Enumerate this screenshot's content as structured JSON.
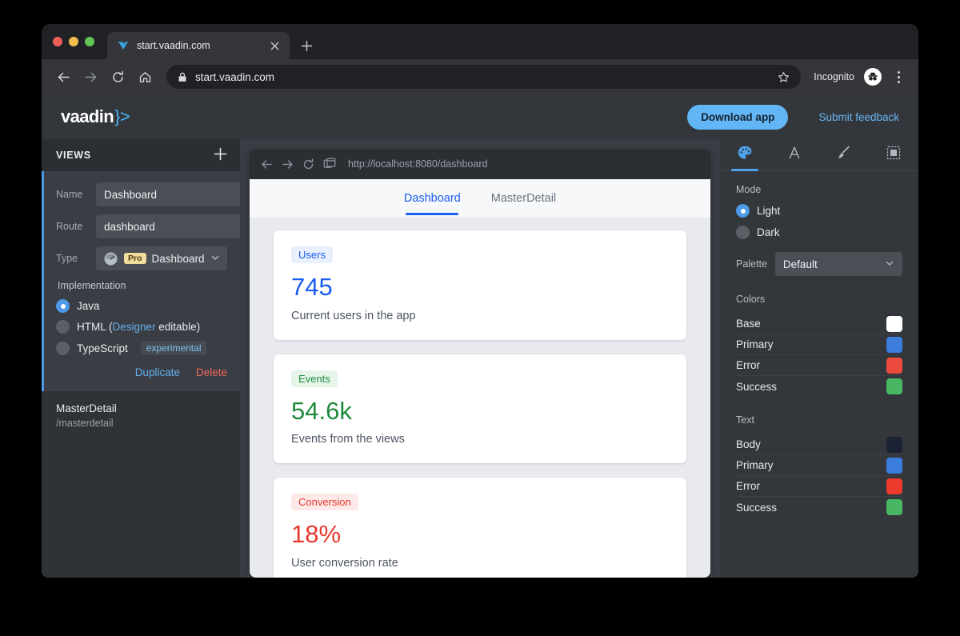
{
  "browser": {
    "tab": {
      "title": "start.vaadin.com",
      "favicon_icon": "vaadin-favicon",
      "close_icon": "close-icon"
    },
    "new_tab_icon": "plus-icon",
    "back_icon": "arrow-left-icon",
    "forward_icon": "arrow-right-icon",
    "reload_icon": "reload-icon",
    "home_icon": "home-icon",
    "lock_icon": "lock-icon",
    "url": "start.vaadin.com",
    "bookmark_icon": "star-icon",
    "profile_label": "Incognito",
    "profile_icon": "incognito-avatar-icon",
    "menu_icon": "kebab-menu-icon"
  },
  "appheader": {
    "logo_text": "vaadin",
    "logo_mark": "}>",
    "download_label": "Download app",
    "feedback_label": "Submit feedback",
    "accent": "#62b6f5"
  },
  "sidebar": {
    "heading": "VIEWS",
    "add_icon": "plus-icon",
    "selected_view": {
      "fields": [
        {
          "label": "Name",
          "value": "Dashboard"
        },
        {
          "label": "Route",
          "value": "dashboard"
        }
      ],
      "type": {
        "label": "Type",
        "icon": "gauge-icon",
        "badge": "Pro",
        "value": "Dashboard",
        "chevron_icon": "chevron-down-icon"
      },
      "implementation": {
        "title": "Implementation",
        "options": [
          {
            "label": "Java",
            "selected": true
          },
          {
            "label": "HTML (",
            "link": "Designer",
            "label_after": " editable)",
            "selected": false
          },
          {
            "label": "TypeScript",
            "tag": "experimental",
            "selected": false
          }
        ]
      },
      "actions": {
        "duplicate": "Duplicate",
        "delete": "Delete"
      },
      "accent": "#4c9ae8"
    },
    "other_views": [
      {
        "name": "MasterDetail",
        "route": "/masterdetail"
      }
    ]
  },
  "preview": {
    "back_icon": "arrow-left-icon",
    "forward_icon": "arrow-right-icon",
    "reload_icon": "reload-icon",
    "windows_icon": "copy-window-icon",
    "url": "http://localhost:8080/dashboard",
    "tabs": [
      {
        "label": "Dashboard",
        "active": true
      },
      {
        "label": "MasterDetail",
        "active": false
      }
    ],
    "cards": [
      {
        "badge": "Users",
        "value": "745",
        "description": "Current users in the app",
        "tone": "blue"
      },
      {
        "badge": "Events",
        "value": "54.6k",
        "description": "Events from the views",
        "tone": "green"
      },
      {
        "badge": "Conversion",
        "value": "18%",
        "description": "User conversion rate",
        "tone": "red"
      }
    ]
  },
  "theme": {
    "tabs": [
      {
        "icon": "palette-icon",
        "active": true
      },
      {
        "icon": "typography-icon",
        "active": false
      },
      {
        "icon": "brush-icon",
        "active": false
      },
      {
        "icon": "shape-icon",
        "active": false
      }
    ],
    "mode": {
      "title": "Mode",
      "options": [
        {
          "label": "Light",
          "selected": true
        },
        {
          "label": "Dark",
          "selected": false
        }
      ]
    },
    "palette": {
      "label": "Palette",
      "value": "Default",
      "chevron_icon": "chevron-down-icon"
    },
    "colors": {
      "title": "Colors",
      "items": [
        {
          "label": "Base",
          "color": "#ffffff"
        },
        {
          "label": "Primary",
          "color": "#3b7ddd"
        },
        {
          "label": "Error",
          "color": "#ec4a3c"
        },
        {
          "label": "Success",
          "color": "#48b663"
        }
      ]
    },
    "text": {
      "title": "Text",
      "items": [
        {
          "label": "Body",
          "color": "#1b2233"
        },
        {
          "label": "Primary",
          "color": "#3b7ddd"
        },
        {
          "label": "Error",
          "color": "#ec3b2c"
        },
        {
          "label": "Success",
          "color": "#48b663"
        }
      ]
    }
  }
}
